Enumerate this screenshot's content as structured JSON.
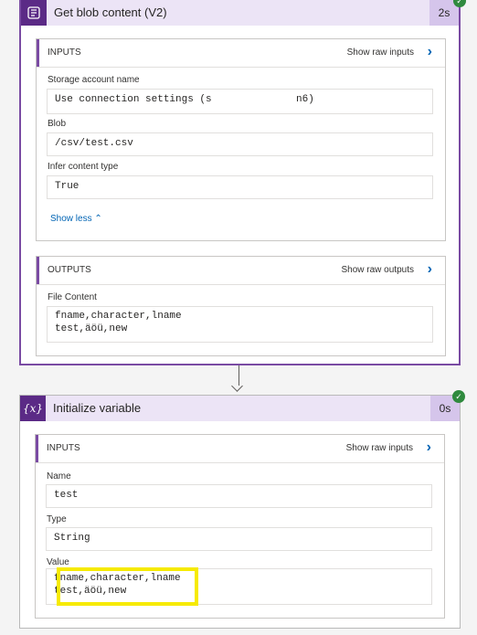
{
  "action1": {
    "title": "Get blob content (V2)",
    "duration": "2s",
    "inputs": {
      "heading": "INPUTS",
      "raw_link": "Show raw inputs",
      "fields": [
        {
          "label": "Storage account name",
          "value": "Use connection settings (s              n6)"
        },
        {
          "label": "Blob",
          "value": "/csv/test.csv"
        },
        {
          "label": "Infer content type",
          "value": "True"
        }
      ],
      "show_less": "Show less"
    },
    "outputs": {
      "heading": "OUTPUTS",
      "raw_link": "Show raw outputs",
      "fields": [
        {
          "label": "File Content",
          "line1": "fname,character,lname",
          "line2": "test,äöü,new"
        }
      ]
    }
  },
  "action2": {
    "title": "Initialize variable",
    "icon_text": "{x}",
    "duration": "0s",
    "inputs": {
      "heading": "INPUTS",
      "raw_link": "Show raw inputs",
      "fields": [
        {
          "label": "Name",
          "value": "test"
        },
        {
          "label": "Type",
          "value": "String"
        },
        {
          "label": "Value",
          "line1": "fname,character,lname",
          "line2": "test,äöü,new"
        }
      ]
    }
  },
  "colors": {
    "accent": "#7a4ba3",
    "header_bg": "#ece4f6",
    "success": "#2f8a3e",
    "link": "#0064b4",
    "highlight": "#f6ea00"
  },
  "icons": {
    "blob": "blob-storage-icon",
    "variable": "variable-icon",
    "success": "check-icon",
    "chevron": "chevron-right-icon"
  }
}
